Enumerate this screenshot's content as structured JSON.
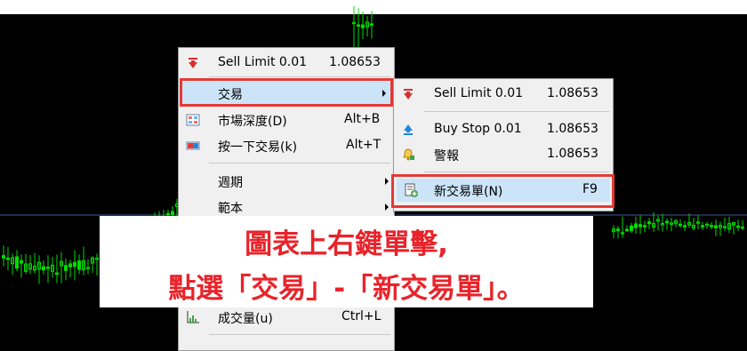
{
  "colors": {
    "red_highlight": "#e53935",
    "menu_highlight": "#cce4f7",
    "overlay_text": "#e8232a",
    "candle": "#00dd00"
  },
  "main_menu": {
    "items": [
      {
        "icon": "sell-limit-icon",
        "label": "Sell Limit 0.01",
        "value": "1.08653"
      },
      {
        "label": "交易",
        "submenu": true,
        "highlighted": true
      },
      {
        "icon": "market-depth-icon",
        "label": "市場深度(D)",
        "value": "Alt+B"
      },
      {
        "icon": "one-click-trading-icon",
        "label": "按一下交易(k)",
        "value": "Alt+T"
      },
      {
        "label": "週期",
        "submenu": true
      },
      {
        "label": "範本",
        "submenu": true
      },
      {
        "icon": "volumes-icon",
        "label": "成交量(u)",
        "value": "Ctrl+L"
      }
    ]
  },
  "submenu": {
    "items": [
      {
        "icon": "sell-limit-icon",
        "label": "Sell Limit 0.01",
        "value": "1.08653"
      },
      {
        "icon": "buy-stop-icon",
        "label": "Buy Stop 0.01",
        "value": "1.08653"
      },
      {
        "icon": "alarm-bell-icon",
        "label": "警報",
        "value": "1.08653"
      },
      {
        "icon": "new-order-icon",
        "label": "新交易單(N)",
        "value": "F9",
        "highlighted": true
      }
    ]
  },
  "overlay": {
    "line1": "圖表上右鍵單擊,",
    "line2": "點選「交易」-「新交易單」。"
  }
}
